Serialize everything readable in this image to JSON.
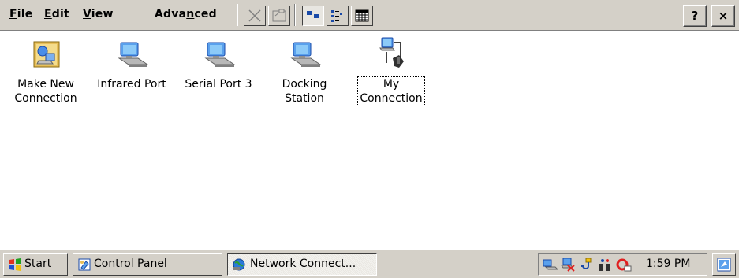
{
  "menu": {
    "file": {
      "ul": "F",
      "rest": "ile"
    },
    "edit": {
      "ul": "E",
      "rest": "dit"
    },
    "view": {
      "ul": "V",
      "rest": "iew"
    },
    "advanced": {
      "pre": "Adva",
      "ul": "n",
      "rest": "ced"
    }
  },
  "toolbar": {
    "buttons": [
      "delete-icon",
      "properties-icon",
      "large-icons-view-icon",
      "list-view-icon",
      "details-view-icon"
    ],
    "active": "large-icons-view-icon"
  },
  "window_buttons": {
    "help": "?",
    "close": "×"
  },
  "items": [
    {
      "label": "Make New\nConnection",
      "icon": "make-new-connection-icon"
    },
    {
      "label": "Infrared Port",
      "icon": "network-connection-icon"
    },
    {
      "label": "Serial Port 3",
      "icon": "network-connection-icon"
    },
    {
      "label": "Docking\nStation",
      "icon": "network-connection-icon"
    },
    {
      "label": "My\nConnection",
      "icon": "dialup-connection-icon",
      "focused": true
    }
  ],
  "taskbar": {
    "start": "Start",
    "tasks": [
      {
        "label": "Control Panel",
        "active": false
      },
      {
        "label": "Network Connect...",
        "active": true
      }
    ],
    "clock": "1:59 PM",
    "tray_icons": [
      "network-icon",
      "network-disconnected-icon",
      "usb-icon",
      "connection-status-icon",
      "sync-icon"
    ]
  }
}
